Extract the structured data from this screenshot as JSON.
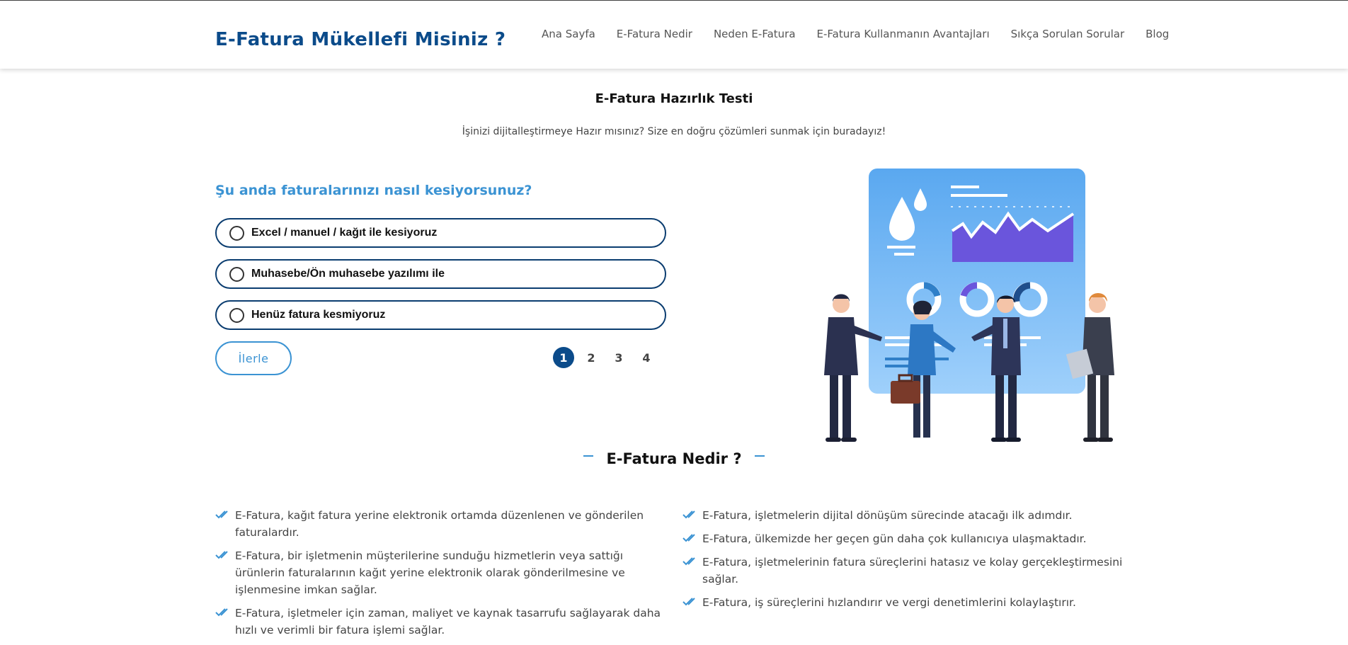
{
  "header": {
    "brand": "E-Fatura Mükellefi Misiniz ?",
    "nav": [
      "Ana Sayfa",
      "E-Fatura Nedir",
      "Neden E-Fatura",
      "E-Fatura Kullanmanın Avantajları",
      "Sıkça Sorulan Sorular",
      "Blog"
    ]
  },
  "test": {
    "title": "E-Fatura Hazırlık Testi",
    "subtitle": "İşinizi dijitalleştirmeye Hazır mısınız? Size en doğru çözümleri sunmak için buradayız!",
    "question": "Şu anda faturalarınızı nasıl kesiyorsunuz?",
    "options": [
      "Excel / manuel / kağıt ile kesiyoruz",
      "Muhasebe/Ön muhasebe yazılımı ile",
      "Henüz fatura kesmiyoruz"
    ],
    "next_label": "İlerle",
    "pages": [
      "1",
      "2",
      "3",
      "4"
    ],
    "active_page": "1"
  },
  "section": {
    "title": "E-Fatura Nedir ?",
    "left_items": [
      "E-Fatura, kağıt fatura yerine elektronik ortamda düzenlenen ve gönderilen faturalardır.",
      "E-Fatura, bir işletmenin müşterilerine sunduğu hizmetlerin veya sattığı ürünlerin faturalarının kağıt yerine elektronik olarak gönderilmesine ve işlenmesine imkan sağlar.",
      "E-Fatura, işletmeler için zaman, maliyet ve kaynak tasarrufu sağlayarak daha hızlı ve verimli bir fatura işlemi sağlar."
    ],
    "right_items": [
      "E-Fatura, işletmelerin dijital dönüşüm sürecinde atacağı ilk adımdır.",
      "E-Fatura, ülkemizde her geçen gün daha çok kullanıcıya ulaşmaktadır.",
      "E-Fatura, işletmelerinin fatura süreçlerini hatasız ve kolay gerçekleştirmesini sağlar.",
      "E-Fatura, iş süreçlerini hızlandırır ve vergi denetimlerini kolaylaştırır."
    ]
  },
  "colors": {
    "brand": "#0b4b8a",
    "accent": "#3b93d3",
    "option_border": "#0b3d70"
  },
  "icons": {
    "list_bullet": "double-check-icon"
  }
}
